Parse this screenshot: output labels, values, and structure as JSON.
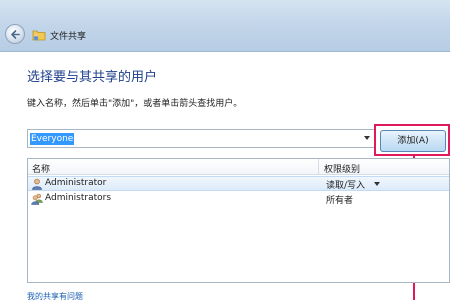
{
  "window": {
    "title": "文件共享",
    "back_icon": "back-arrow-icon",
    "title_icon": "shared-folder-icon"
  },
  "main": {
    "heading": "选择要与其共享的用户",
    "instruction": "键入名称，然后单击\"添加\"，或者单击箭头查找用户。",
    "combo_value": "Everyone",
    "add_button_label": "添加(A)"
  },
  "list": {
    "columns": [
      "名称",
      "权限级别"
    ],
    "rows": [
      {
        "name": "Administrator",
        "permission": "读取/写入",
        "icon": "user-icon",
        "selected": true,
        "has_dropdown": true
      },
      {
        "name": "Administrators",
        "permission": "所有者",
        "icon": "group-icon",
        "selected": false,
        "has_dropdown": false
      }
    ]
  },
  "footer": {
    "help_link": "我的共享有问题"
  },
  "colors": {
    "heading": "#1e3f8c",
    "annotation": "#e0195a",
    "selection": "#3399ff",
    "link": "#1a5fb4"
  }
}
